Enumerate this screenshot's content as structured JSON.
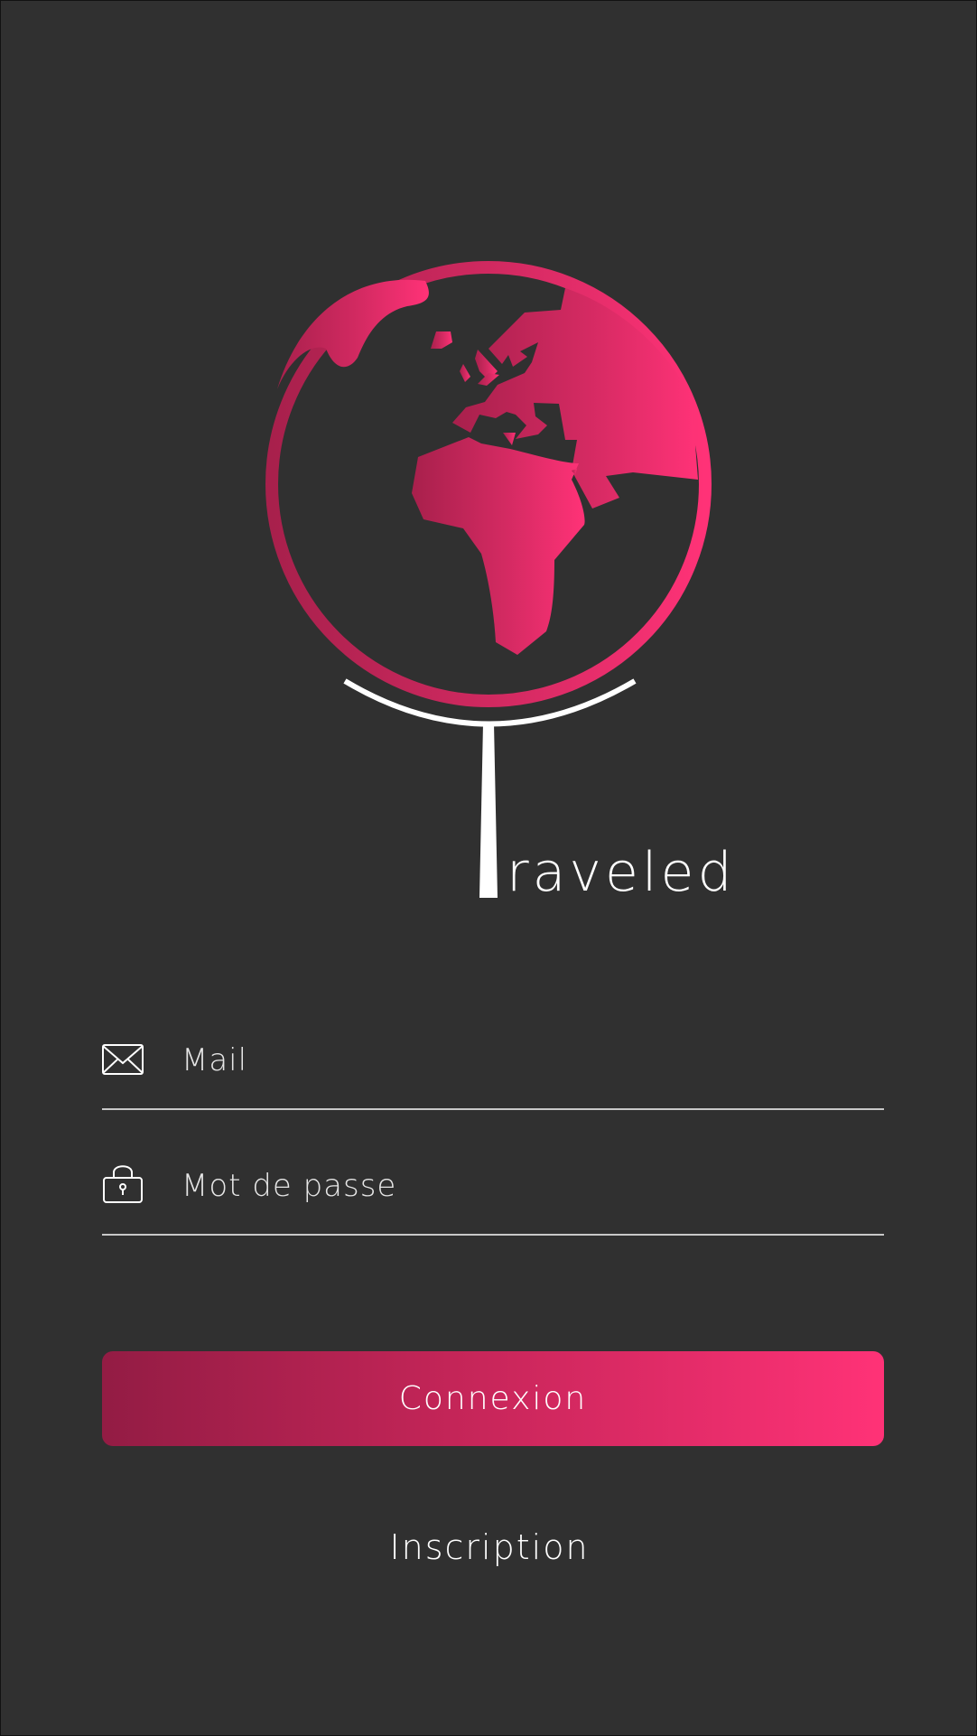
{
  "brand": {
    "wordmark": "raveled",
    "gradient_start": "#931c44",
    "gradient_end": "#ff3277"
  },
  "form": {
    "email": {
      "icon": "envelope-icon",
      "placeholder": "Mail",
      "value": ""
    },
    "password": {
      "icon": "lock-icon",
      "placeholder": "Mot de passe",
      "value": ""
    }
  },
  "actions": {
    "login_label": "Connexion",
    "signup_label": "Inscription"
  },
  "colors": {
    "background": "#303030",
    "text": "#ffffff",
    "divider": "#c8c8c8"
  }
}
